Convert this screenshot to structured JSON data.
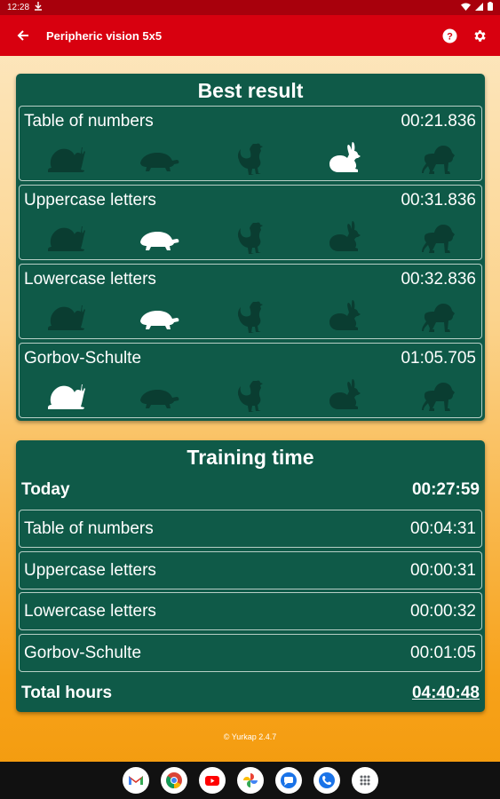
{
  "status_bar": {
    "time": "12:28"
  },
  "app_bar": {
    "title": "Peripheric vision 5x5"
  },
  "best_result": {
    "title": "Best result",
    "rows": [
      {
        "name": "Table of numbers",
        "time": "00:21.836",
        "level": 4
      },
      {
        "name": "Uppercase letters",
        "time": "00:31.836",
        "level": 2
      },
      {
        "name": "Lowercase letters",
        "time": "00:32.836",
        "level": 2
      },
      {
        "name": "Gorbov-Schulte",
        "time": "01:05.705",
        "level": 1
      }
    ],
    "animal_icons": [
      "snail-icon",
      "turtle-icon",
      "rooster-icon",
      "rabbit-icon",
      "lion-icon"
    ]
  },
  "training_time": {
    "title": "Training time",
    "today_label": "Today",
    "today_value": "00:27:59",
    "rows": [
      {
        "name": "Table of numbers",
        "time": "00:04:31"
      },
      {
        "name": "Uppercase letters",
        "time": "00:00:31"
      },
      {
        "name": "Lowercase letters",
        "time": "00:00:32"
      },
      {
        "name": "Gorbov-Schulte",
        "time": "00:01:05"
      }
    ],
    "total_label": "Total hours",
    "total_value": "04:40:48"
  },
  "footer": {
    "copyright": "© Yurkap 2.4.7"
  },
  "nav_apps": [
    "gmail-icon",
    "chrome-icon",
    "youtube-icon",
    "photos-icon",
    "messages-icon",
    "phone-icon",
    "app-drawer-icon"
  ],
  "colors": {
    "status_bar": "#a8000c",
    "app_bar": "#d8000f",
    "card": "#0f5a48",
    "animal_inactive": "#0a3d31",
    "animal_active": "#ffffff"
  }
}
